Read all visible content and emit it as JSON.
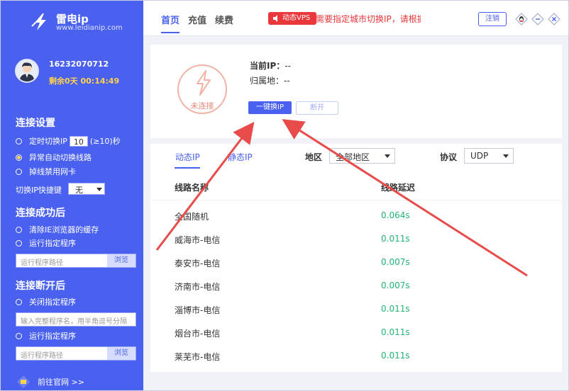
{
  "app": {
    "name": "雷电ip",
    "url": "www.leidianip.com"
  },
  "user": {
    "phone": "16232070712",
    "remaining": "剩余0天 00:14:49"
  },
  "settings": {
    "connect_title": "连接设置",
    "timed_switch_prefix": "定时切换IP",
    "timed_switch_value": "10",
    "timed_switch_suffix": "(≥10)秒",
    "auto_switch_label": "异常自动切换线路",
    "disable_nic_label": "掉线禁用网卡",
    "hotkey_label": "切换IP快捷键",
    "hotkey_value": "无",
    "after_connect_title": "连接成功后",
    "clear_cache_label": "清除IE浏览器的缓存",
    "run_program_label": "运行指定程序",
    "path_placeholder": "运行程序路径",
    "browse_label": "浏览",
    "after_disconnect_title": "连接断开后",
    "close_program_label": "关闭指定程序",
    "close_program_placeholder": "输入完整程序名，用半角逗号分隔",
    "run_program_label_2": "运行指定程序",
    "path_placeholder_2": "运行程序路径",
    "browse_label_2": "浏览",
    "site_link": "前往官网 >>"
  },
  "topbar": {
    "tabs": [
      "首页",
      "充值",
      "续费"
    ],
    "vps_badge": "动态VPS",
    "notice": "需要指定城市切换IP，请根据",
    "logout": "注销"
  },
  "status": {
    "label": "未连接",
    "current_ip_label": "当前IP：",
    "current_ip_value": "--",
    "location_label": "归属地：",
    "location_value": "--",
    "connect_button": "一键换IP",
    "disconnect_button": "断开"
  },
  "list": {
    "tabs": [
      "动态IP",
      "静态IP"
    ],
    "region_label": "地区",
    "region_value": "全部地区",
    "protocol_label": "协议",
    "protocol_value": "UDP",
    "headers": [
      "线路名称",
      "线路延迟"
    ],
    "rows": [
      {
        "name": "全国随机",
        "latency": "0.064s"
      },
      {
        "name": "威海市-电信",
        "latency": "0.011s"
      },
      {
        "name": "泰安市-电信",
        "latency": "0.007s"
      },
      {
        "name": "济南市-电信",
        "latency": "0.007s"
      },
      {
        "name": "淄博市-电信",
        "latency": "0.011s"
      },
      {
        "name": "烟台市-电信",
        "latency": "0.011s"
      },
      {
        "name": "莱芜市-电信",
        "latency": "0.011s"
      }
    ]
  },
  "colors": {
    "brand": "#4a61f0",
    "alert": "#e9373b",
    "latency": "#22b573",
    "remaining": "#ffd34e"
  }
}
